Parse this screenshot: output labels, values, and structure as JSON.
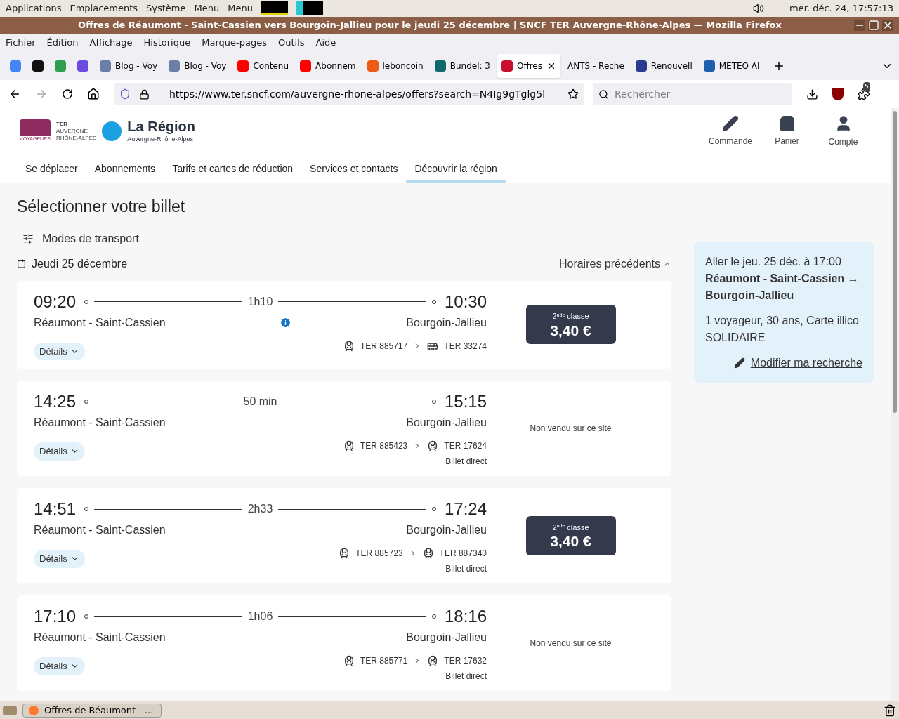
{
  "top_panel": {
    "menus": [
      "Applications",
      "Emplacements",
      "Système",
      "Menu",
      "Menu"
    ],
    "clock": "mer. déc. 24, 17:57:13"
  },
  "window": {
    "title": "Offres de Réaumont - Saint-Cassien vers Bourgoin-Jallieu pour le jeudi 25 décembre | SNCF TER Auvergne-Rhône-Alpes — Mozilla Firefox"
  },
  "menubar": [
    "Fichier",
    "Édition",
    "Affichage",
    "Historique",
    "Marque-pages",
    "Outils",
    "Aide"
  ],
  "tabs": [
    {
      "color": "#4285f4",
      "selected": false
    },
    {
      "color": "#111111",
      "selected": false
    },
    {
      "color": "#2e9e4f",
      "selected": false
    },
    {
      "color": "#6c4ce0",
      "selected": false
    },
    {
      "label": "Blog - Voy",
      "color": "#6b7fa8",
      "selected": false
    },
    {
      "label": "Blog - Voy",
      "color": "#6b7fa8",
      "selected": false
    },
    {
      "label": "Contenu",
      "color": "#ff0000",
      "selected": false
    },
    {
      "label": "Abonnem",
      "color": "#ff0000",
      "selected": false
    },
    {
      "label": "leboncoin",
      "color": "#ec5a13",
      "selected": false
    },
    {
      "label": "Bundel: 3",
      "color": "#0f6b6b",
      "selected": false
    },
    {
      "label": "Offres",
      "color": "#c8102e",
      "selected": true
    },
    {
      "label": "ANTS - Reche",
      "selected": false
    },
    {
      "label": "Renouvell",
      "color": "#2a3c8f",
      "selected": false
    },
    {
      "label": "METEO AI",
      "color": "#1f5fae",
      "selected": false
    }
  ],
  "url": "https://www.ter.sncf.com/auvergne-rhone-alpes/offers?search=N4Ig9gTglg5l",
  "search": {
    "placeholder": "Rechercher"
  },
  "extension_badge": "5",
  "site": {
    "ter_lines": [
      "TER",
      "AUVERGNE",
      "RHÔNE-ALPES"
    ],
    "sncf_sub": "VOYAGEURS",
    "region_name": "La Région",
    "region_sub": "Auvergne-Rhône-Alpes",
    "actions": [
      {
        "kind": "order",
        "label": "Commande"
      },
      {
        "kind": "basket",
        "label": "Panier"
      },
      {
        "kind": "account",
        "label": "Compte"
      }
    ],
    "nav": [
      {
        "label": "Se déplacer",
        "selected": false
      },
      {
        "label": "Abonnements",
        "selected": false
      },
      {
        "label": "Tarifs et cartes de réduction",
        "selected": false
      },
      {
        "label": "Services et contacts",
        "selected": false
      },
      {
        "label": "Découvrir la région",
        "selected": true
      }
    ]
  },
  "heading": "Sélectionner votre billet",
  "modes_button": "Modes de transport",
  "date": "Jeudi 25 décembre",
  "previous_button": "Horaires précédents",
  "journeys": [
    {
      "departure": "09:20",
      "duration": "1h10",
      "arrival": "10:30",
      "from": "Réaumont - Saint-Cassien",
      "to": "Bourgoin-Jallieu",
      "info": true,
      "details": "Détails",
      "segments": [
        {
          "kind": "train",
          "label": "TER 885717"
        },
        {
          "kind": "bus",
          "label": "TER 33274"
        }
      ],
      "offer": {
        "kind": "price",
        "class": "2$^{nde}$ classe",
        "price": "3,40 €"
      }
    },
    {
      "departure": "14:25",
      "duration": "50 min",
      "arrival": "15:15",
      "from": "Réaumont - Saint-Cassien",
      "to": "Bourgoin-Jallieu",
      "info": false,
      "details": "Détails",
      "segments": [
        {
          "kind": "train",
          "label": "TER 885423"
        },
        {
          "kind": "train",
          "label": "TER 17624"
        }
      ],
      "note": "Billet direct",
      "offer": {
        "kind": "not_sold",
        "text": "Non vendu sur ce site"
      }
    },
    {
      "departure": "14:51",
      "duration": "2h33",
      "arrival": "17:24",
      "from": "Réaumont - Saint-Cassien",
      "to": "Bourgoin-Jallieu",
      "info": false,
      "details": "Détails",
      "segments": [
        {
          "kind": "train",
          "label": "TER 885723"
        },
        {
          "kind": "train",
          "label": "TER 887340"
        }
      ],
      "note": "Billet direct",
      "offer": {
        "kind": "price",
        "class": "2$^{nde}$ classe",
        "price": "3,40 €"
      }
    },
    {
      "departure": "17:10",
      "duration": "1h06",
      "arrival": "18:16",
      "from": "Réaumont - Saint-Cassien",
      "to": "Bourgoin-Jallieu",
      "info": false,
      "details": "Détails",
      "segments": [
        {
          "kind": "train",
          "label": "TER 885771"
        },
        {
          "kind": "train",
          "label": "TER 17632"
        }
      ],
      "note": "Billet direct",
      "offer": {
        "kind": "not_sold",
        "text": "Non vendu sur ce site"
      }
    }
  ],
  "summary": {
    "outbound": "Aller le jeu. 25 déc. à 17:00",
    "route": "Réaumont - Saint-Cassien → Bourgoin-Jallieu",
    "passengers": "1 voyageur, 30 ans, Carte illico SOLIDAIRE",
    "modify": "Modifier ma recherche"
  },
  "taskbar": {
    "window_button": "Offres de Réaumont - ..."
  }
}
